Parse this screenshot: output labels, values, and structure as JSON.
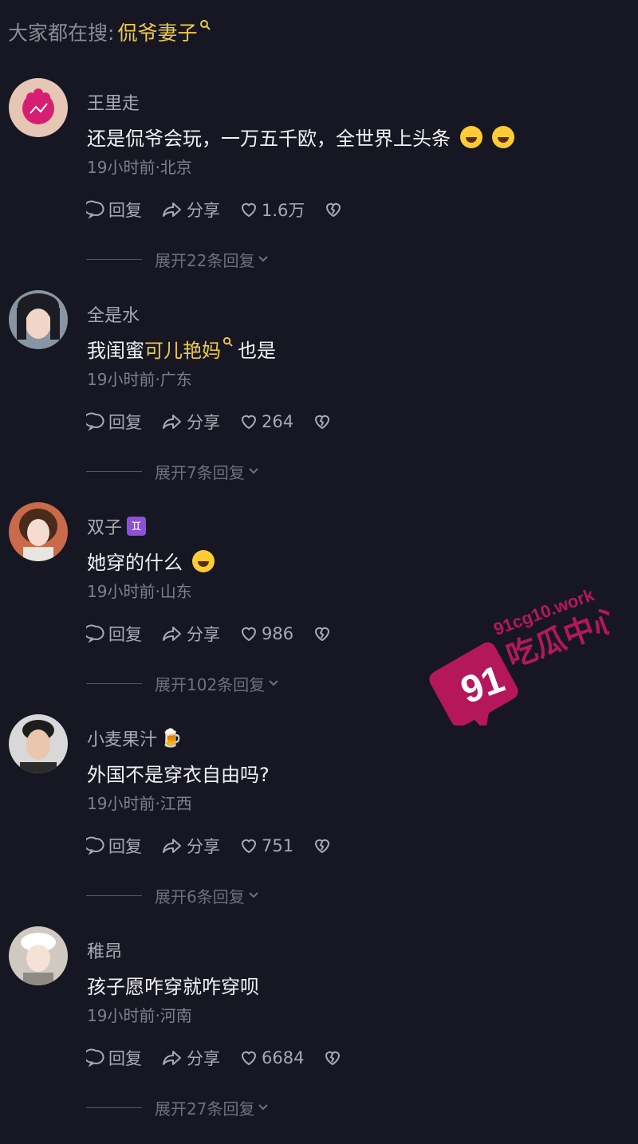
{
  "search": {
    "prefix": "大家都在搜:",
    "term": "侃爷妻子"
  },
  "actions": {
    "reply": "回复",
    "share": "分享"
  },
  "comments": [
    {
      "user": "王里走",
      "text_before": "还是侃爷会玩，一万五千欧，全世界上头条",
      "mention": "",
      "text_after": "",
      "emoji_count": 2,
      "meta": "19小时前·北京",
      "likes": "1.6万",
      "expand": "展开22条回复"
    },
    {
      "user": "全是水",
      "text_before": "我闺蜜",
      "mention": "可儿艳妈",
      "text_after": "也是",
      "emoji_count": 0,
      "meta": "19小时前·广东",
      "likes": "264",
      "expand": "展开7条回复"
    },
    {
      "user": "双子",
      "badge": "♊",
      "text_before": "她穿的什么",
      "mention": "",
      "text_after": "",
      "emoji_count": 1,
      "meta": "19小时前·山东",
      "likes": "986",
      "expand": "展开102条回复"
    },
    {
      "user": "小麦果汁",
      "badge": "🍺",
      "text_before": "外国不是穿衣自由吗?",
      "mention": "",
      "text_after": "",
      "emoji_count": 0,
      "meta": "19小时前·江西",
      "likes": "751",
      "expand": "展开6条回复"
    },
    {
      "user": "稚昂",
      "text_before": "孩子愿咋穿就咋穿呗",
      "mention": "",
      "text_after": "",
      "emoji_count": 0,
      "meta": "19小时前·河南",
      "likes": "6684",
      "expand": "展开27条回复"
    }
  ],
  "watermark": {
    "number": "91",
    "url": "91cg10.work",
    "name": "吃瓜中心"
  },
  "colors": {
    "background": "#161722",
    "accent": "#f1c944",
    "watermark": "#b5175b"
  }
}
